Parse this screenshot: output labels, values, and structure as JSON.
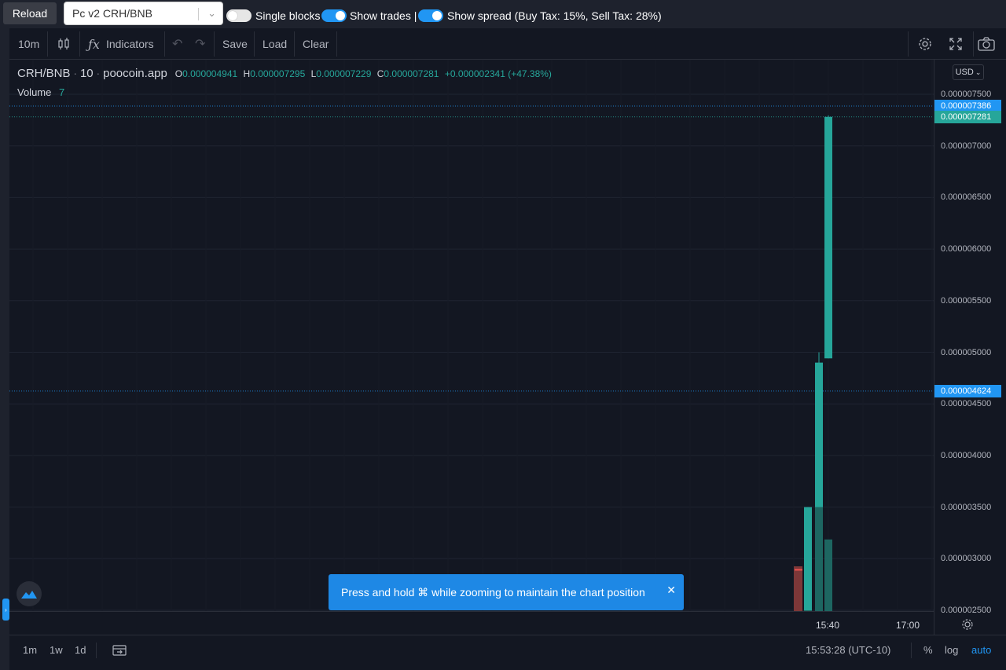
{
  "topbar": {
    "reload_label": "Reload",
    "pair_select_value": "Pc v2 CRH/BNB",
    "single_blocks_label": "Single blocks",
    "show_trades_label": "Show trades |",
    "show_spread_label": "Show spread (Buy Tax: 15%, Sell Tax: 28%)",
    "single_blocks_on": false,
    "show_trades_on": true,
    "show_spread_on": true
  },
  "toolbar": {
    "interval": "10m",
    "indicators_label": "Indicators",
    "save_label": "Save",
    "load_label": "Load",
    "clear_label": "Clear"
  },
  "legend": {
    "symbol": "CRH/BNB",
    "interval": "10",
    "source": "poocoin.app",
    "open_key": "O",
    "open": "0.000004941",
    "high_key": "H",
    "high": "0.000007295",
    "low_key": "L",
    "low": "0.000007229",
    "close_key": "C",
    "close": "0.000007281",
    "change": "+0.000002341 (+47.38%)",
    "volume_label": "Volume",
    "volume_value": "7"
  },
  "currency": "USD",
  "price_axis": {
    "ticks": [
      "0.000007500",
      "0.000007000",
      "0.000006500",
      "0.000006000",
      "0.000005500",
      "0.000005000",
      "0.000004500",
      "0.000004000",
      "0.000003500",
      "0.000003000",
      "0.000002500"
    ],
    "badges": [
      {
        "value": "0.000007386",
        "color": "#2196f3"
      },
      {
        "value": "0.000007281",
        "color": "#26a69a"
      },
      {
        "value": "0.000004624",
        "color": "#2196f3"
      }
    ]
  },
  "time_axis": {
    "ticks": [
      "15:40",
      "17:00"
    ]
  },
  "bottombar": {
    "ranges": [
      "1m",
      "1w",
      "1d"
    ],
    "clock": "15:53:28 (UTC-10)",
    "percent_label": "%",
    "log_label": "log",
    "auto_label": "auto"
  },
  "toast": {
    "message": "Press and hold ⌘ while zooming to maintain the chart position"
  },
  "colors": {
    "up": "#26a69a",
    "down": "#ef5350",
    "accent": "#2196f3",
    "bg": "#131722"
  },
  "chart_data": {
    "type": "candlestick",
    "ylim": [
      2.5e-06,
      7.5e-06
    ],
    "candles": [
      {
        "open": 2.9e-06,
        "high": 2.9e-06,
        "low": 2.9e-06,
        "close": 2.9e-06,
        "dir": "down"
      },
      {
        "open": 2.5e-06,
        "high": 3.5e-06,
        "low": 2.5e-06,
        "close": 3.5e-06,
        "dir": "up"
      },
      {
        "open": 3.5e-06,
        "high": 5e-06,
        "low": 3.5e-06,
        "close": 4.9e-06,
        "dir": "up"
      },
      {
        "open": 4.941e-06,
        "high": 7.295e-06,
        "low": 4.941e-06,
        "close": 7.281e-06,
        "dir": "up"
      }
    ],
    "volumes": [
      {
        "value": 3,
        "dir": "down"
      },
      {
        "value": 5,
        "dir": "up"
      },
      {
        "value": 7,
        "dir": "up"
      },
      {
        "value": 4.8,
        "dir": "up"
      }
    ],
    "price_lines": [
      7.386e-06,
      7.281e-06,
      4.624e-06
    ]
  }
}
